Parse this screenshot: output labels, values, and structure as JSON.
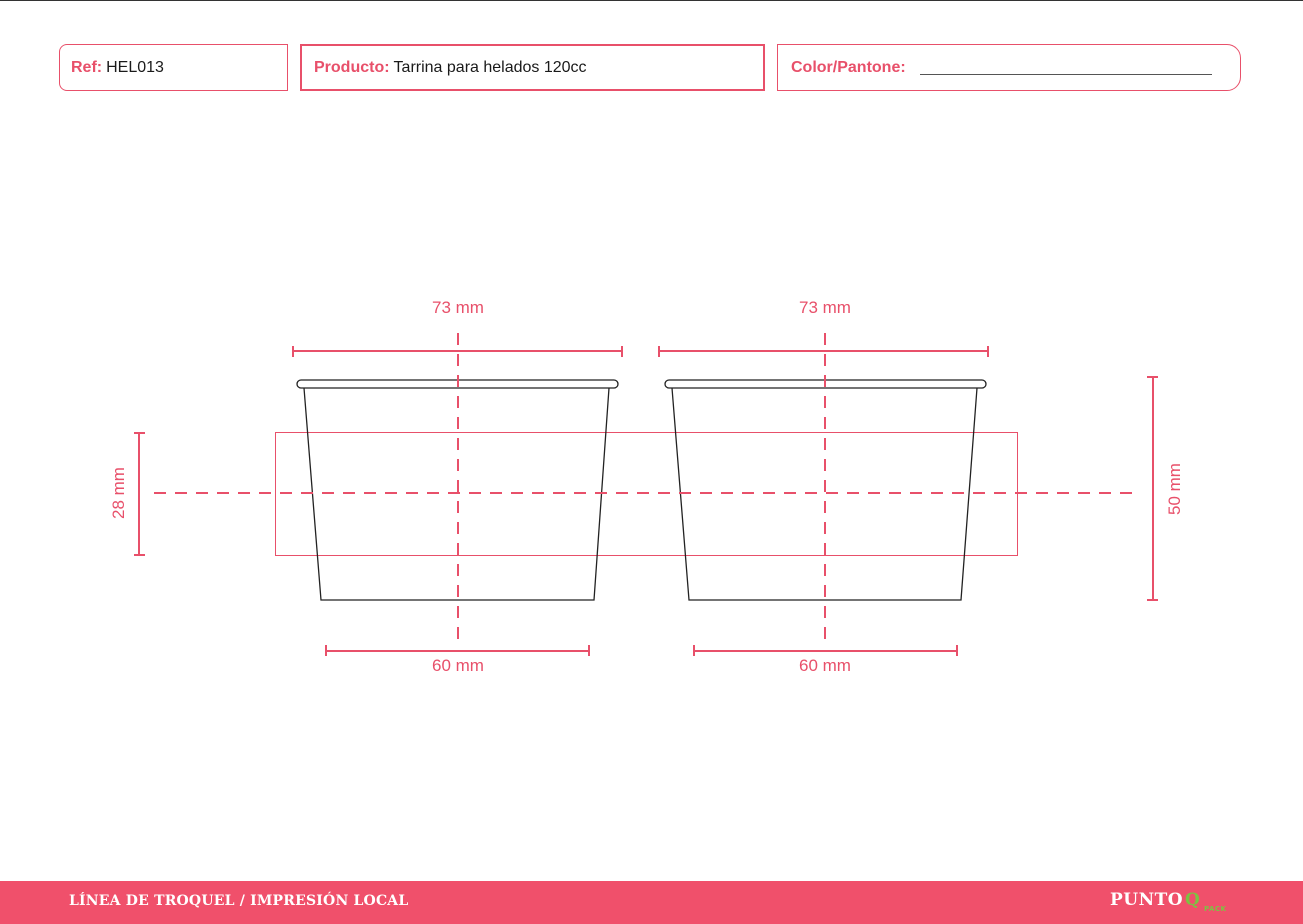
{
  "header": {
    "ref_label": "Ref:",
    "ref_value": "HEL013",
    "product_label": "Producto:",
    "product_value": "Tarrina para helados 120cc",
    "color_label": "Color/Pantone:"
  },
  "dimensions": {
    "top_width_left": "73 mm",
    "top_width_right": "73 mm",
    "bottom_width_left": "60 mm",
    "bottom_width_right": "60 mm",
    "print_height": "28 mm",
    "total_height": "50 mm"
  },
  "footer": {
    "title": "LÍNEA DE TROQUEL / IMPRESIÓN LOCAL",
    "logo_main": "PUNTO",
    "logo_q": "Q",
    "logo_sub": "PACK"
  },
  "colors": {
    "accent": "#e8506a",
    "footer_bg": "#f0506b",
    "logo_green": "#7dc242"
  }
}
